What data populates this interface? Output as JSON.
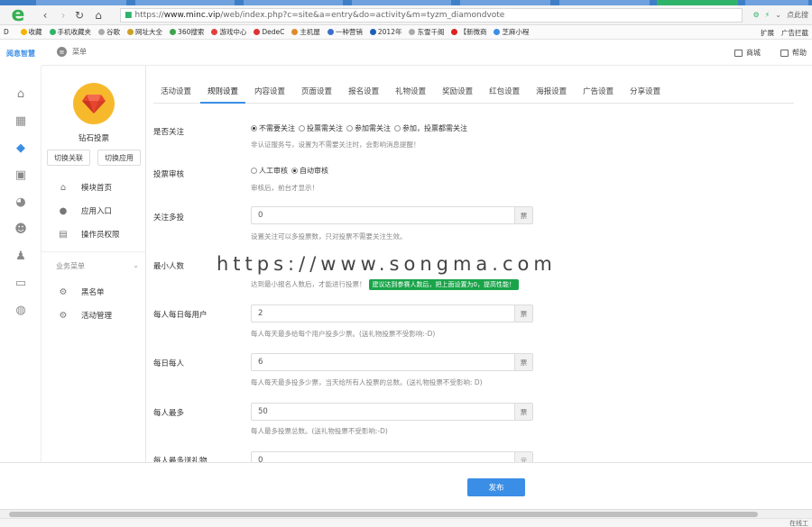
{
  "browser": {
    "url_prefix": "https://",
    "url_host": "www.minc.vip",
    "url_path": "/web/index.php?c=site&a=entry&do=activity&m=tyzm_diamondvote",
    "right_hint": "点此搜",
    "bookmarks": [
      "收藏",
      "手机收藏夹",
      "谷歌",
      "网址大全",
      "360搜索",
      "游戏中心",
      "DedeC",
      "主机屋",
      "一种营销",
      "2012年",
      "东雪千阁",
      "【新微商",
      "芝麻小程"
    ],
    "bookmarks_right": [
      "扩展",
      "广告拦截"
    ]
  },
  "header": {
    "brand": "阅息智慧",
    "menu_label": "菜单",
    "mall_label": "商城",
    "help_label": "帮助"
  },
  "app": {
    "name": "钻石投票",
    "switch_link": "切换关联",
    "switch_app": "切换应用",
    "menu": [
      {
        "icon": "home-icon",
        "label": "模块首页"
      },
      {
        "icon": "chat-icon",
        "label": "应用入口"
      },
      {
        "icon": "file-icon",
        "label": "操作员权限"
      }
    ],
    "group_label": "业务菜单",
    "group_items": [
      {
        "icon": "gear-icon",
        "label": "黑名单"
      },
      {
        "icon": "gear-icon",
        "label": "活动管理"
      }
    ]
  },
  "tabs": [
    "活动设置",
    "规则设置",
    "内容设置",
    "页面设置",
    "报名设置",
    "礼物设置",
    "奖励设置",
    "红包设置",
    "海报设置",
    "广告设置",
    "分享设置"
  ],
  "active_tab": 1,
  "form": {
    "follow": {
      "label": "是否关注",
      "options": [
        "不需要关注",
        "投票需关注",
        "参加需关注",
        "参加，投票都需关注"
      ],
      "selected": 0,
      "hint": "非认证服务号，设置为不需要关注时，会影响消息提醒！"
    },
    "review": {
      "label": "投票审核",
      "options": [
        "人工审核",
        "自动审核"
      ],
      "selected": 1,
      "hint": "审核后，前台才显示！"
    },
    "multi": {
      "label": "关注多投",
      "value": "0",
      "unit": "票",
      "hint": "设置关注可以多投票数，只对投票不需要关注生效。"
    },
    "min_people": {
      "label": "最小人数",
      "hint": "达到最小报名人数后，才能进行投票！",
      "badge": "建议达到参赛人数后，把上面设置为0，提高性能！"
    },
    "daily_per_user": {
      "label": "每人每日每用户",
      "value": "2",
      "unit": "票",
      "hint": "每人每天最多给每个用户投多少票。(送礼物投票不受影响:-D)"
    },
    "daily_per_person": {
      "label": "每日每人",
      "value": "6",
      "unit": "票",
      "hint": "每人每天最多投多少票，当天给所有人投票的总数。(送礼物投票不受影响: D)"
    },
    "max_per_person": {
      "label": "每人最多",
      "value": "50",
      "unit": "票",
      "hint": "每人最多投票总数。(送礼物投票不受影响:-D)"
    },
    "gift": {
      "label": "每人最多送礼物",
      "value": "0",
      "unit": "元"
    }
  },
  "watermark": "https://www.songma.com",
  "publish_label": "发布",
  "status_text": "在线工"
}
